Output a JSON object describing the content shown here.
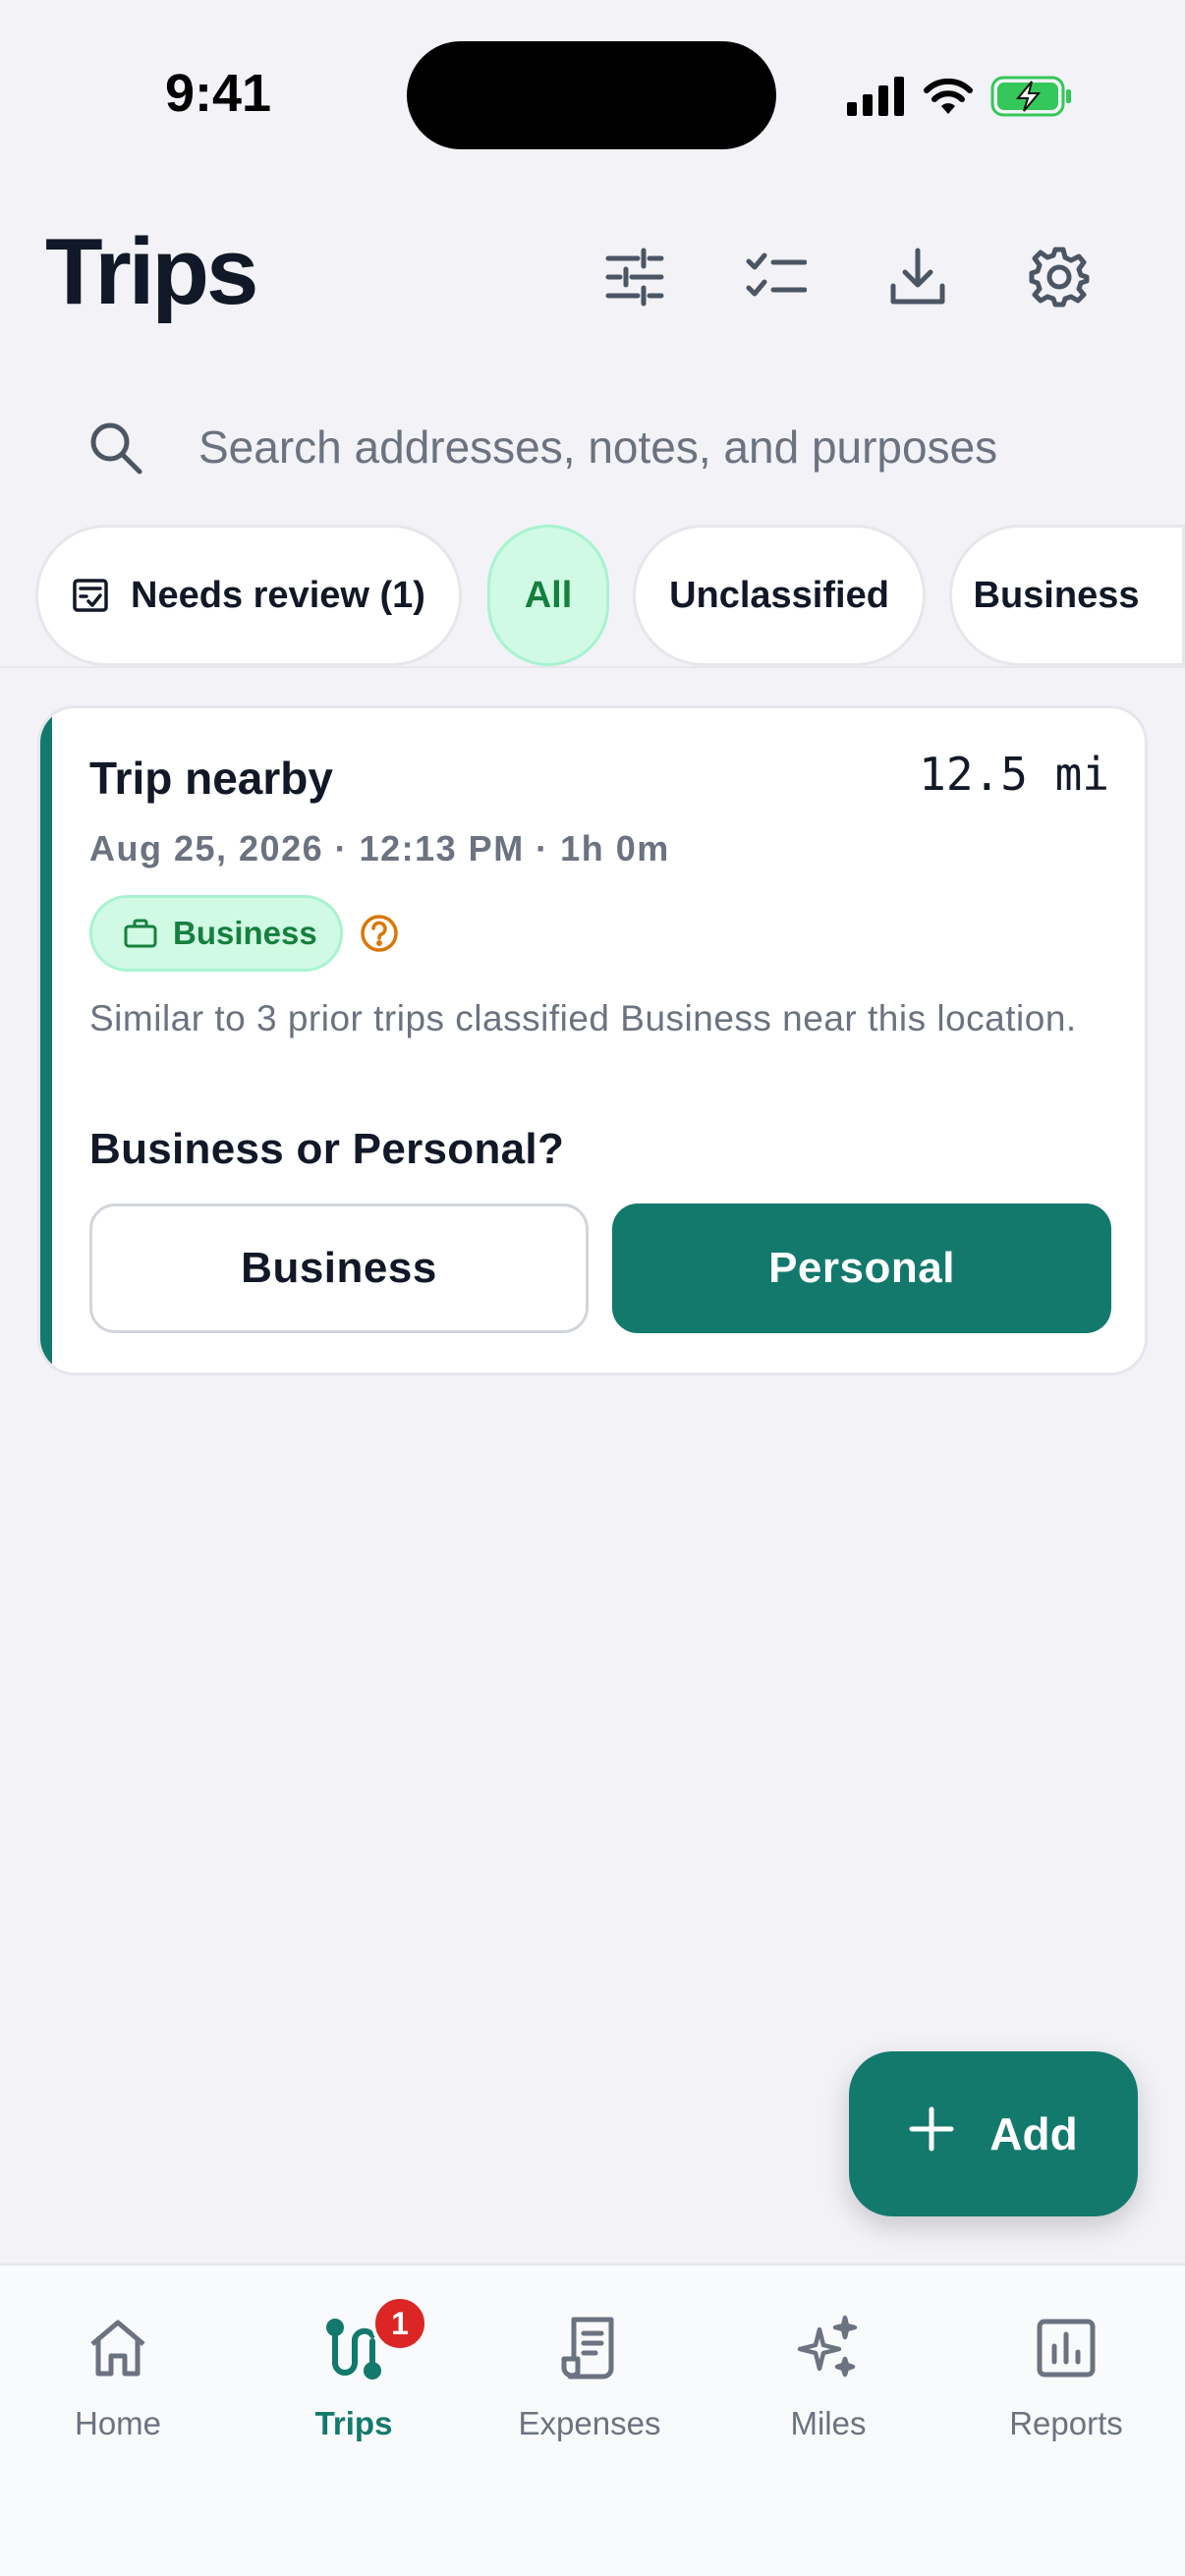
{
  "status_bar": {
    "time": "9:41"
  },
  "header": {
    "title": "Trips"
  },
  "search": {
    "placeholder": "Search addresses, notes, and purposes"
  },
  "filters": [
    {
      "label": "Needs review (1)",
      "active": false
    },
    {
      "label": "All",
      "active": true
    },
    {
      "label": "Unclassified",
      "active": false
    },
    {
      "label": "Business",
      "active": false
    }
  ],
  "trip": {
    "title": "Trip nearby",
    "distance": "12.5 mi",
    "meta": "Aug 25, 2026 · 12:13 PM · 1h 0m",
    "badge": "Business",
    "similar": "Similar to 3 prior trips classified Business near this location.",
    "question": "Business or Personal?",
    "business_label": "Business",
    "personal_label": "Personal"
  },
  "fab": {
    "label": "Add"
  },
  "nav": {
    "home": "Home",
    "trips": "Trips",
    "trips_badge": "1",
    "expenses": "Expenses",
    "miles": "Miles",
    "reports": "Reports"
  },
  "colors": {
    "accent": "#13796d",
    "badge_bg": "#d1fae5",
    "badge_text": "#15803d",
    "alert": "#dc2626",
    "help": "#d97706"
  },
  "icons": [
    "sliders-icon",
    "checklist-icon",
    "download-icon",
    "gear-icon",
    "search-icon",
    "review-icon",
    "briefcase-icon",
    "help-icon",
    "plus-icon",
    "home-icon",
    "trips-icon",
    "expenses-icon",
    "miles-icon",
    "reports-icon"
  ]
}
